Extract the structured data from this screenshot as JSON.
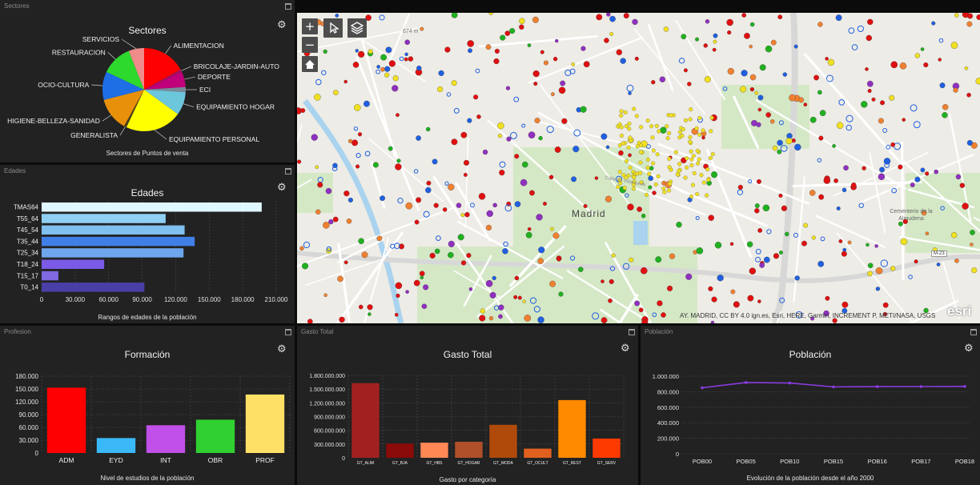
{
  "panels": {
    "sectores": {
      "title": "Sectores",
      "heading": "Sectores",
      "caption": "Sectores de Puntos de venta"
    },
    "edades": {
      "title": "Edades",
      "heading": "Edades",
      "caption": "Rangos de edades de la población"
    },
    "profesion": {
      "title": "Profesion",
      "heading": "Formación",
      "caption": "Nivel de estudios de la población"
    },
    "gasto": {
      "title": "Gasto Total",
      "heading": "Gasto Total",
      "caption": "Gasto por categoría"
    },
    "poblacion": {
      "title": "Población",
      "heading": "Población",
      "caption": "Evolución de la población desde el año 2000"
    }
  },
  "icons": {
    "settings": "gear-icon",
    "maximize": "maximize-icon",
    "zoom_in": "plus-icon",
    "zoom_out": "minus-icon",
    "home": "home-icon",
    "select": "select-icon",
    "layers": "layers-icon"
  },
  "map": {
    "city_label": "Madrid",
    "attribution": "AY. MADRID, CC BY 4.0 ign.es, Esri, HERE, Garmin, INCREMENT P, METI/NASA, USGS",
    "logo": "esri",
    "buttons": {
      "zoom_in": "+",
      "zoom_out": "−"
    },
    "place_labels": [
      "Cementerio de la Almudena",
      "M-23",
      "674 m",
      "Calle de Villanueva"
    ],
    "colors": {
      "land": "#eeece6",
      "park": "#d5e8c6",
      "water": "#a9d3ee",
      "road": "#ffffff",
      "highway": "#d7d7d7"
    }
  },
  "chart_data": [
    {
      "id": "sectores",
      "type": "pie",
      "title": "Sectores",
      "slices": [
        {
          "label": "ALIMENTACION",
          "value": 17,
          "color": "#ff0000"
        },
        {
          "label": "BRICOLAJE-JARDIN-AUTO",
          "value": 1,
          "color": "#a01060"
        },
        {
          "label": "DEPORTE",
          "value": 6,
          "color": "#c0007a"
        },
        {
          "label": "ECI",
          "value": 2,
          "color": "#7a8a99"
        },
        {
          "label": "EQUIPAMIENTO HOGAR",
          "value": 9,
          "color": "#6cc7dc"
        },
        {
          "label": "EQUIPAMIENTO PERSONAL",
          "value": 22,
          "color": "#ffff00"
        },
        {
          "label": "GENERALISTA",
          "value": 1,
          "color": "#4a3e1a"
        },
        {
          "label": "HIGIENE-BELLEZA-SANIDAD",
          "value": 13,
          "color": "#e8900a"
        },
        {
          "label": "OCIO-CULTURA",
          "value": 11,
          "color": "#1e6ee6"
        },
        {
          "label": "RESTAURACION",
          "value": 12,
          "color": "#2ed92e"
        },
        {
          "label": "SERVICIOS",
          "value": 6,
          "color": "#f08b8b"
        }
      ]
    },
    {
      "id": "edades",
      "type": "bar",
      "orientation": "horizontal",
      "title": "Edades",
      "xlabel": "Rangos de edades de la población",
      "xlim": [
        0,
        210000
      ],
      "ticks": [
        "0",
        "30.000",
        "60.000",
        "90.000",
        "120.000",
        "150.000",
        "180.000",
        "210.000"
      ],
      "categories": [
        "TMAS64",
        "T55_64",
        "T45_54",
        "T35_44",
        "T25_34",
        "T18_24",
        "T15_17",
        "T0_14"
      ],
      "values": [
        197000,
        111000,
        128000,
        137000,
        127000,
        56000,
        15000,
        92000
      ],
      "colors": [
        "#e0f8ff",
        "#8fd0f4",
        "#7fc0ef",
        "#3f7fe6",
        "#6ea6ee",
        "#7a5ae6",
        "#7f68e0",
        "#4a3fa6"
      ]
    },
    {
      "id": "profesion",
      "type": "bar",
      "title": "Formación",
      "xlabel": "Nivel de estudios de la población",
      "ylim": [
        0,
        180000
      ],
      "ticks": [
        "0",
        "30.000",
        "60.000",
        "90.000",
        "120.000",
        "150.000",
        "180.000"
      ],
      "categories": [
        "ADM",
        "EYD",
        "INT",
        "OBR",
        "PROF"
      ],
      "values": [
        153000,
        35000,
        65000,
        78000,
        137000
      ],
      "colors": [
        "#ff0000",
        "#3ab8f8",
        "#c050e8",
        "#30d030",
        "#ffe066"
      ]
    },
    {
      "id": "gasto",
      "type": "bar",
      "title": "Gasto Total",
      "xlabel": "Gasto por categoría",
      "ylim": [
        0,
        1800000000
      ],
      "ticks": [
        "0",
        "300.000.000",
        "600.000.000",
        "900.000.000",
        "1.200.000.000",
        "1.500.000.000",
        "1.800.000.000"
      ],
      "categories": [
        "GT_ALIM",
        "GT_BJA",
        "GT_HBS",
        "GT_HOGAR",
        "GT_MODA",
        "GT_OCULT",
        "GT_REST",
        "GT_SERV"
      ],
      "values": [
        1630000000,
        310000000,
        330000000,
        350000000,
        720000000,
        200000000,
        1260000000,
        420000000
      ],
      "colors": [
        "#a32020",
        "#8b0a0a",
        "#ff8855",
        "#b0502a",
        "#b04a0a",
        "#e06020",
        "#ff8a00",
        "#ff3a00"
      ]
    },
    {
      "id": "poblacion",
      "type": "line",
      "title": "Población",
      "xlabel": "Evolución de la población desde el año 2000",
      "ylim": [
        0,
        1000000
      ],
      "ticks": [
        "0",
        "200.000",
        "400.000",
        "600.000",
        "800.000",
        "1.000.000"
      ],
      "categories": [
        "POB00",
        "POB05",
        "POB10",
        "POB15",
        "POB16",
        "POB17",
        "POB18"
      ],
      "values": [
        850000,
        918000,
        912000,
        862000,
        865000,
        866000,
        868000
      ],
      "color": "#8b3be0"
    }
  ]
}
